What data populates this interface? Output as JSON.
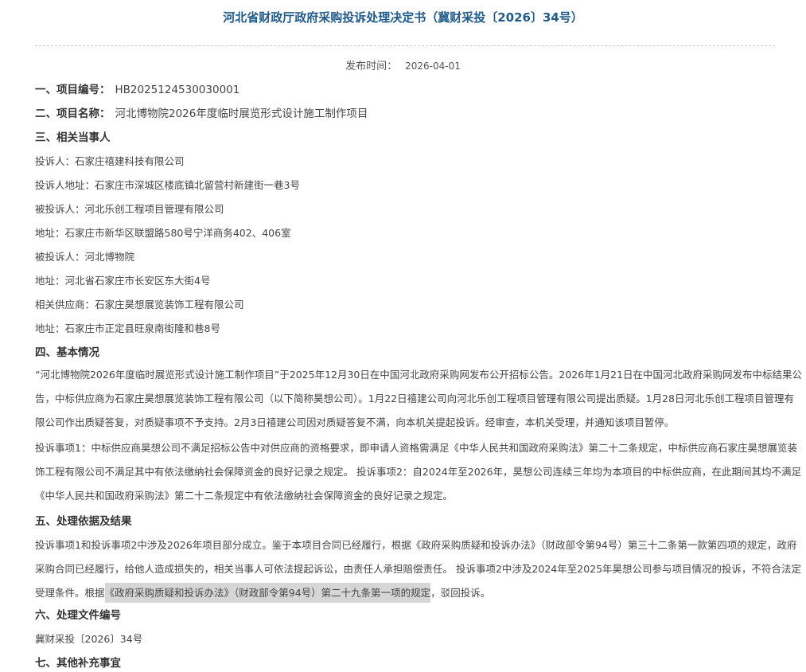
{
  "title": "河北省财政厅政府采购投诉处理决定书（冀财采投〔2026〕34号）",
  "publish": {
    "label": "发布时间：",
    "value": "2026-04-01"
  },
  "sections": {
    "s1": {
      "heading": "一、项目编号：",
      "value": "HB2025124530030001"
    },
    "s2": {
      "heading": "二、项目名称：",
      "value": "河北博物院2026年度临时展览形式设计施工制作项目"
    },
    "s3": {
      "heading": "三、相关当事人"
    },
    "s4": {
      "heading": "四、基本情况"
    },
    "s5": {
      "heading": "五、处理依据及结果"
    },
    "s6": {
      "heading": "六、处理文件编号"
    },
    "s7": {
      "heading": "七、其他补充事宜"
    }
  },
  "parties": [
    "投诉人：石家庄禧建科技有限公司",
    "投诉人地址：石家庄市深城区楼底镇北留营村新建街一巷3号",
    "被投诉人：河北乐创工程项目管理有限公司",
    "地址：石家庄市新华区联盟路580号宁洋商务402、406室",
    "被投诉人：河北博物院",
    "地址：河北省石家庄市长安区东大街4号",
    "相关供应商：石家庄昊想展览装饰工程有限公司",
    "地址：石家庄市正定县旺泉南街隆和巷8号"
  ],
  "basic_para1": [
    "“河北博物院2026年度临时展览形式设计施工制作项目”于2025年12月30日在中国河北政府采购网发布公开招标公告。2026年1月21日在中国河北政府采购网发布中标结果公",
    "告，中标供应商为石家庄昊想展览装饰工程有限公司（以下简称昊想公司）。1月22日禧建公司向河北乐创工程项目管理有限公司提出质疑。1月28日河北乐创工程项目管理有",
    "限公司作出质疑答复，对质疑事项不予支持。2月3日禧建公司因对质疑答复不满，向本机关提起投诉。经审查，本机关受理，并通知该项目暂停。"
  ],
  "basic_para2": [
    "投诉事项1：中标供应商昊想公司不满足招标公告中对供应商的资格要求，即申请人资格需满足《中华人民共和国政府采购法》第二十二条规定，中标供应商石家庄昊想展览装",
    "饰工程有限公司不满足其中有依法缴纳社会保障资金的良好记录之规定。 投诉事项2：自2024年至2026年，昊想公司连续三年均为本项目的中标供应商，在此期间其均不满足",
    "《中华人民共和国政府采购法》第二十二条规定中有依法缴纳社会保障资金的良好记录之规定。"
  ],
  "result_para": {
    "line1": "投诉事项1和投诉事项2中涉及2026年项目部分成立。鉴于本项目合同已经履行，根据《政府采购质疑和投诉办法》（财政部令第94号）第三十二条第一款第四项的规定，政府",
    "line2": "采购合同已经履行，给他人造成损失的，相关当事人可依法提起诉讼，由责任人承担赔偿责任。 投诉事项2中涉及2024年至2025年昊想公司参与项目情况的投诉，不符合法定",
    "line3_a": "受理条件。根据",
    "line3_hl": "《政府采购质疑和投诉办法》（财政部令第94号）第二十九条第一项的规定",
    "line3_b": "，驳回投诉。"
  },
  "doc_number": "冀财采投〔2026〕34号"
}
